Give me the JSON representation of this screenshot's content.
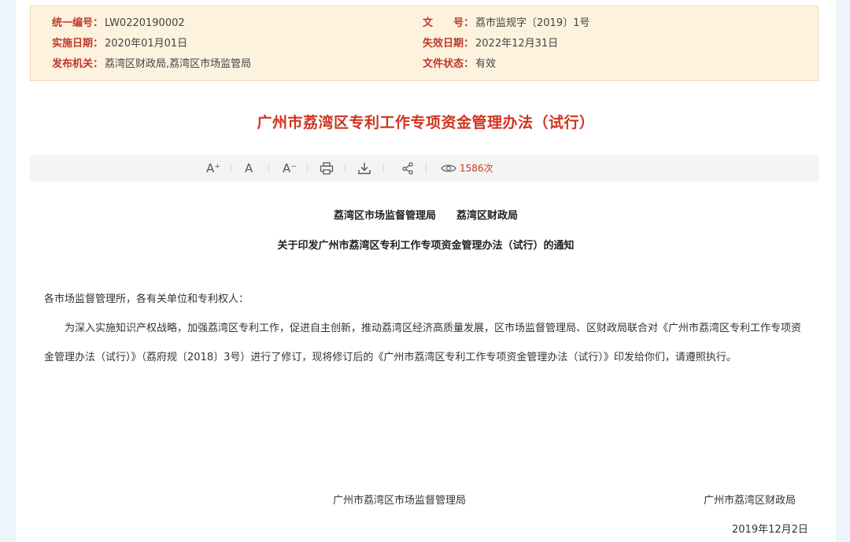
{
  "meta": {
    "code_label": "统一编号：",
    "code_value": "LW0220190002",
    "doc_label": "文　　号：",
    "doc_value": "荔市监规字〔2019〕1号",
    "effective_label": "实施日期：",
    "effective_value": "2020年01月01日",
    "expire_label": "失效日期：",
    "expire_value": "2022年12月31日",
    "issuer_label": "发布机关：",
    "issuer_value": "荔湾区财政局,荔湾区市场监管局",
    "status_label": "文件状态：",
    "status_value": "有效"
  },
  "title": "广州市荔湾区专利工作专项资金管理办法（试行）",
  "toolbar": {
    "font_increase": "A⁺",
    "font_normal": "A",
    "font_decrease": "A⁻",
    "views": "1586次",
    "icons": [
      "font-increase-icon",
      "font-normal-icon",
      "font-decrease-icon",
      "print-icon",
      "download-icon",
      "share-icon",
      "eye-icon"
    ]
  },
  "notice": {
    "issuers": "荔湾区市场监督管理局　　荔湾区财政局",
    "subject": "关于印发广州市荔湾区专利工作专项资金管理办法（试行）的通知"
  },
  "body": {
    "salutation": "各市场监督管理所，各有关单位和专利权人：",
    "paragraph": "为深入实施知识产权战略，加强荔湾区专利工作，促进自主创新，推动荔湾区经济高质量发展，区市场监督管理局、区财政局联合对《广州市荔湾区专利工作专项资金管理办法（试行）》（荔府规〔2018〕3号）进行了修订，现将修订后的《广州市荔湾区专利工作专项资金管理办法（试行）》印发给你们，请遵照执行。"
  },
  "signature": {
    "left": "广州市荔湾区市场监督管理局",
    "right": "广州市荔湾区财政局",
    "date": "2019年12月2日"
  },
  "colors": {
    "accent_red": "#d0341f",
    "meta_background": "#fcf2de"
  }
}
